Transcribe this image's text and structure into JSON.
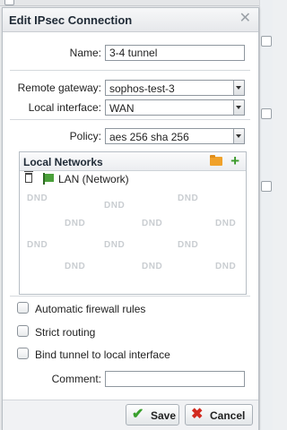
{
  "dialog": {
    "title": "Edit IPsec Connection",
    "close_glyph": "✕"
  },
  "form": {
    "name_label": "Name:",
    "name_value": "3-4 tunnel",
    "gateway_label": "Remote gateway:",
    "gateway_value": "sophos-test-3",
    "interface_label": "Local interface:",
    "interface_value": "WAN",
    "policy_label": "Policy:",
    "policy_value": "aes 256 sha 256"
  },
  "networks": {
    "title": "Local Networks",
    "items": [
      {
        "label": "LAN (Network)"
      }
    ],
    "dnd_text": "DND"
  },
  "options": {
    "auto_firewall": "Automatic firewall rules",
    "strict_routing": "Strict routing",
    "bind_tunnel": "Bind tunnel to local interface"
  },
  "comment": {
    "label": "Comment:",
    "value": ""
  },
  "buttons": {
    "save": "Save",
    "cancel": "Cancel"
  },
  "icons": {
    "folder": "folder-icon",
    "add": "plus-icon",
    "delete": "trash-icon",
    "network": "network-flag-icon",
    "save": "checkmark-icon",
    "cancel": "cross-icon"
  },
  "colors": {
    "add": "#3b9a2b",
    "save_check": "#3aa02e",
    "cancel_x": "#d22a1f",
    "folder": "#f0a12a"
  }
}
